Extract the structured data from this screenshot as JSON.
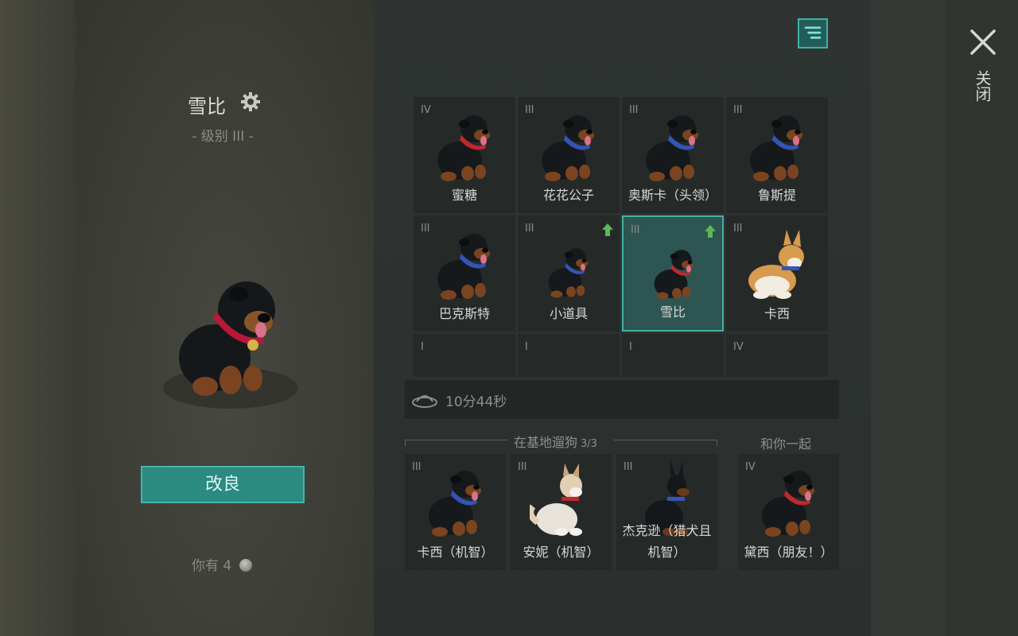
{
  "selected_dog": {
    "name": "雪比",
    "level": "- 级别 III -"
  },
  "improve_button": "改良",
  "currency": {
    "prefix": "你有",
    "amount": "4"
  },
  "close_label": "关闭",
  "dogs": [
    {
      "tier": "IV",
      "name": "蜜糖",
      "breed": "rottweiler",
      "collar": "#c0282e",
      "upgrade": false,
      "selected": false
    },
    {
      "tier": "III",
      "name": "花花公子",
      "breed": "rottweiler",
      "collar": "#3554b8",
      "upgrade": false,
      "selected": false
    },
    {
      "tier": "III",
      "name": "奥斯卡（头领）",
      "breed": "rottweiler",
      "collar": "#3554b8",
      "upgrade": false,
      "selected": false
    },
    {
      "tier": "III",
      "name": "鲁斯提",
      "breed": "rottweiler",
      "collar": "#3554b8",
      "upgrade": false,
      "selected": false
    },
    {
      "tier": "III",
      "name": "巴克斯特",
      "breed": "rottweiler",
      "collar": "#3554b8",
      "upgrade": false,
      "selected": false
    },
    {
      "tier": "III",
      "name": "小道具",
      "breed": "rottweiler-puppy",
      "collar": "#3554b8",
      "upgrade": true,
      "selected": false
    },
    {
      "tier": "III",
      "name": "雪比",
      "breed": "rottweiler-puppy",
      "collar": "#c0282e",
      "upgrade": true,
      "selected": true
    },
    {
      "tier": "III",
      "name": "卡西",
      "breed": "corgi",
      "collar": "#3554b8",
      "upgrade": false,
      "selected": false
    },
    {
      "tier": "I",
      "name": "",
      "breed": "corgi-head",
      "collar": "#3554b8",
      "upgrade": false,
      "selected": false
    },
    {
      "tier": "I",
      "name": "",
      "breed": "corgi-head",
      "collar": "#3554b8",
      "upgrade": false,
      "selected": false
    },
    {
      "tier": "I",
      "name": "",
      "breed": "corgi-head",
      "collar": "#3554b8",
      "upgrade": false,
      "selected": false
    },
    {
      "tier": "IV",
      "name": "",
      "breed": "husky-head",
      "collar": "#3554b8",
      "upgrade": false,
      "selected": false
    }
  ],
  "timer": "10分44秒",
  "base_section": {
    "title": "在基地遛狗",
    "count": "3/3"
  },
  "base_dogs": [
    {
      "tier": "III",
      "name": "卡西（机智）",
      "breed": "rottweiler",
      "collar": "#3554b8"
    },
    {
      "tier": "III",
      "name": "安妮（机智）",
      "breed": "akita",
      "collar": "#c0282e"
    },
    {
      "tier": "III",
      "name": "杰克逊（猎犬且机智）",
      "breed": "doberman",
      "collar": "#3554b8"
    }
  ],
  "with_you_section": {
    "title": "和你一起"
  },
  "with_you_dogs": [
    {
      "tier": "IV",
      "name": "黛西（朋友！）",
      "breed": "rottweiler",
      "collar": "#c0282e"
    }
  ]
}
